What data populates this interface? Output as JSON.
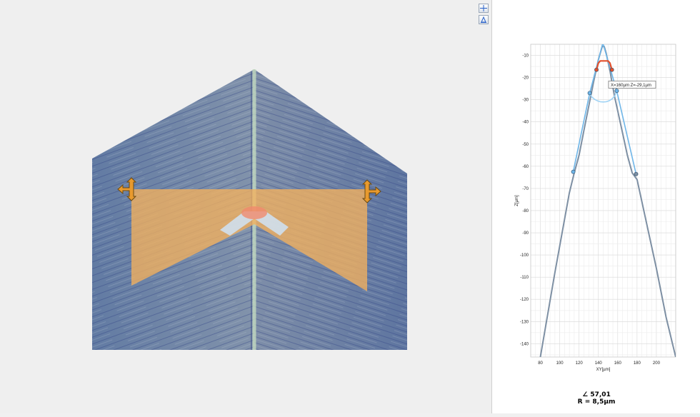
{
  "toolbar": {
    "items": [
      {
        "name": "crosshair-tool-icon"
      },
      {
        "name": "measure-tool-icon"
      }
    ]
  },
  "chart_data": {
    "type": "line",
    "x_label": "XY[µm]",
    "y_label": "Z[µm]",
    "xlim": [
      70,
      220
    ],
    "ylim": [
      -146,
      -5
    ],
    "x_ticks": [
      80,
      100,
      120,
      140,
      160,
      180,
      200
    ],
    "y_ticks": [
      -10,
      -20,
      -30,
      -40,
      -50,
      -60,
      -70,
      -80,
      -90,
      -100,
      -110,
      -120,
      -130,
      -140
    ],
    "grid": true,
    "series": [
      {
        "role": "profile-gray",
        "color": "#7d8fa3",
        "x": [
          65,
          80,
          95,
          110,
          115,
          120,
          125,
          130,
          135,
          138,
          140,
          142,
          144,
          146,
          148,
          150,
          152,
          154,
          157,
          160,
          165,
          170,
          175,
          180,
          190,
          200,
          210,
          220
        ],
        "y": [
          -182,
          -146,
          -108,
          -72,
          -63,
          -55,
          -44,
          -33,
          -22,
          -16,
          -12,
          -9,
          -6,
          -6,
          -9,
          -13,
          -17,
          -22,
          -29,
          -35,
          -45,
          -55,
          -63,
          -66,
          -86,
          -106,
          -128,
          -146
        ]
      },
      {
        "role": "fit-line-left",
        "color": "#6fb6e8",
        "x": [
          114,
          131,
          146
        ],
        "y": [
          -62.5,
          -27,
          -2
        ]
      },
      {
        "role": "fit-line-right",
        "color": "#6fb6e8",
        "x": [
          143,
          159,
          179
        ],
        "y": [
          -2,
          -26,
          -63.5
        ]
      },
      {
        "role": "fit-circle-arc",
        "color": "#9fd3f5",
        "x": [
          131,
          133,
          136,
          139,
          142,
          145,
          148,
          151,
          154,
          157,
          159
        ],
        "y": [
          -27,
          -28.7,
          -29.8,
          -30.5,
          -30.9,
          -31.0,
          -30.9,
          -30.5,
          -29.7,
          -28.3,
          -26
        ]
      },
      {
        "role": "radius-arc",
        "color": "#e2502c",
        "x": [
          138,
          140,
          142,
          146,
          150,
          152,
          154
        ],
        "y": [
          -16.5,
          -13.5,
          -12.5,
          -12.5,
          -12.5,
          -13.5,
          -16.5
        ]
      }
    ],
    "markers": [
      {
        "x": 114,
        "y": -62.5,
        "color": "#6fb6e8"
      },
      {
        "x": 131,
        "y": -27,
        "color": "#6fb6e8"
      },
      {
        "x": 159,
        "y": -26,
        "color": "#6fb6e8"
      },
      {
        "x": 179,
        "y": -63.5,
        "color": "#7d8fa3"
      },
      {
        "x": 138,
        "y": -16.5,
        "color": "#e2502c"
      },
      {
        "x": 154,
        "y": -16.5,
        "color": "#e2502c"
      }
    ],
    "annotation": {
      "text": "X=160µm Z=-29,1µm"
    },
    "results": {
      "angle": "∠  57,01",
      "radius": "R = 8,5µm"
    }
  }
}
